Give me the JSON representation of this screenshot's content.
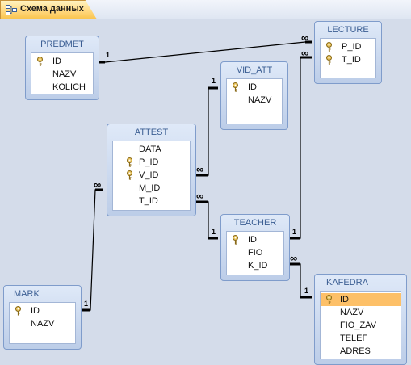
{
  "window": {
    "tab_label": "Схема данных"
  },
  "tables": {
    "predmet": {
      "title": "PREDMET",
      "fields": [
        {
          "name": "ID",
          "key": true
        },
        {
          "name": "NAZV",
          "key": false
        },
        {
          "name": "KOLICH",
          "key": false
        }
      ]
    },
    "lecture": {
      "title": "LECTURE",
      "fields": [
        {
          "name": "P_ID",
          "key": true
        },
        {
          "name": "T_ID",
          "key": true
        }
      ]
    },
    "vid_att": {
      "title": "VID_ATT",
      "fields": [
        {
          "name": "ID",
          "key": true
        },
        {
          "name": "NAZV",
          "key": false
        }
      ]
    },
    "attest": {
      "title": "ATTEST",
      "fields": [
        {
          "name": "DATA",
          "key": false
        },
        {
          "name": "P_ID",
          "key": true
        },
        {
          "name": "V_ID",
          "key": true
        },
        {
          "name": "M_ID",
          "key": false
        },
        {
          "name": "T_ID",
          "key": false
        }
      ]
    },
    "teacher": {
      "title": "TEACHER",
      "fields": [
        {
          "name": "ID",
          "key": true
        },
        {
          "name": "FIO",
          "key": false
        },
        {
          "name": "K_ID",
          "key": false
        }
      ]
    },
    "mark": {
      "title": "MARK",
      "fields": [
        {
          "name": "ID",
          "key": true
        },
        {
          "name": "NAZV",
          "key": false
        }
      ]
    },
    "kafedra": {
      "title": "KAFEDRA",
      "selected_field": "ID",
      "fields": [
        {
          "name": "ID",
          "key": true
        },
        {
          "name": "NAZV",
          "key": false
        },
        {
          "name": "FIO_ZAV",
          "key": false
        },
        {
          "name": "TELEF",
          "key": false
        },
        {
          "name": "ADRES",
          "key": false
        }
      ]
    }
  },
  "relationships": {
    "one_label": "1",
    "many_label": "∞"
  },
  "colors": {
    "tab_accent": "#ffd67a",
    "selected_row": "#fdc068",
    "table_title_text": "#3b5e93",
    "canvas": "#d4dcea"
  },
  "icons": {
    "tab": "relationships-icon",
    "primary_key": "key-icon"
  }
}
